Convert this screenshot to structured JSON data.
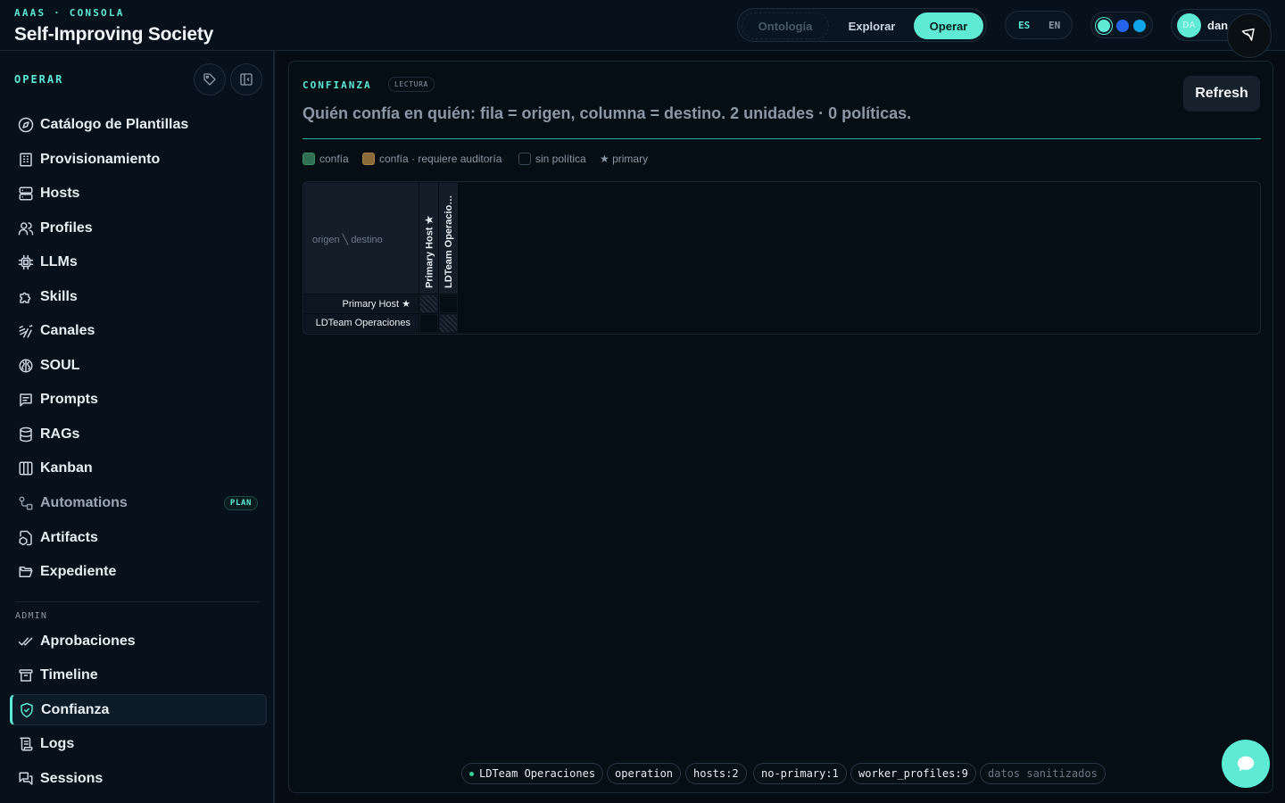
{
  "header": {
    "kicker": "AAAS · CONSOLA",
    "title": "Self-Improving Society",
    "modes": [
      "Ontología",
      "Explorar",
      "Operar"
    ],
    "languages": [
      "ES",
      "EN"
    ],
    "theme_colors": [
      "#5eead4",
      "#2563eb",
      "#0ea5e9"
    ],
    "user": {
      "initials": "DA",
      "name": "dan"
    }
  },
  "sidebar": {
    "title": "OPERAR",
    "items": [
      {
        "label": "Catálogo de Plantillas",
        "icon": "compass-icon"
      },
      {
        "label": "Provisionamiento",
        "icon": "building-icon"
      },
      {
        "label": "Hosts",
        "icon": "server-icon"
      },
      {
        "label": "Profiles",
        "icon": "users-icon"
      },
      {
        "label": "LLMs",
        "icon": "cpu-icon"
      },
      {
        "label": "Skills",
        "icon": "puzzle-icon"
      },
      {
        "label": "Canales",
        "icon": "antenna-icon"
      },
      {
        "label": "SOUL",
        "icon": "brain-icon"
      },
      {
        "label": "Prompts",
        "icon": "message-square-icon"
      },
      {
        "label": "RAGs",
        "icon": "database-icon"
      },
      {
        "label": "Kanban",
        "icon": "columns-icon"
      },
      {
        "label": "Automations",
        "icon": "workflow-icon",
        "badge": "PLAN"
      },
      {
        "label": "Artifacts",
        "icon": "file-box-icon"
      },
      {
        "label": "Expediente",
        "icon": "folder-open-icon"
      }
    ],
    "admin_title": "ADMIN",
    "admin_items": [
      {
        "label": "Aprobaciones",
        "icon": "check-check-icon"
      },
      {
        "label": "Timeline",
        "icon": "archive-icon"
      },
      {
        "label": "Confianza",
        "icon": "shield-check-icon",
        "active": true
      },
      {
        "label": "Logs",
        "icon": "scroll-text-icon"
      },
      {
        "label": "Sessions",
        "icon": "messages-icon"
      }
    ]
  },
  "panel": {
    "kicker": "CONFIANZA",
    "badge": "LECTURA",
    "description": "Quién confía en quién: fila = origen, columna = destino. 2 unidades · 0 políticas.",
    "refresh_label": "Refresh",
    "legend": [
      {
        "label": "confía",
        "color": "#2f6f52"
      },
      {
        "label": "confía · requiere auditoría",
        "color": "#8a6a3a"
      },
      {
        "label": "sin política",
        "color": "transparent"
      },
      {
        "label": "★ primary",
        "color": ""
      }
    ],
    "matrix": {
      "corner_label": "origen ╲ destino",
      "columns": [
        "Primary Host ★",
        "LDTeam Operacio…"
      ],
      "rows": [
        "Primary Host ★",
        "LDTeam Operaciones"
      ]
    },
    "footer_chips": [
      "LDTeam Operaciones",
      "operation",
      "hosts:2",
      "no-primary:1",
      "worker_profiles:9",
      "datos sanitizados"
    ]
  }
}
